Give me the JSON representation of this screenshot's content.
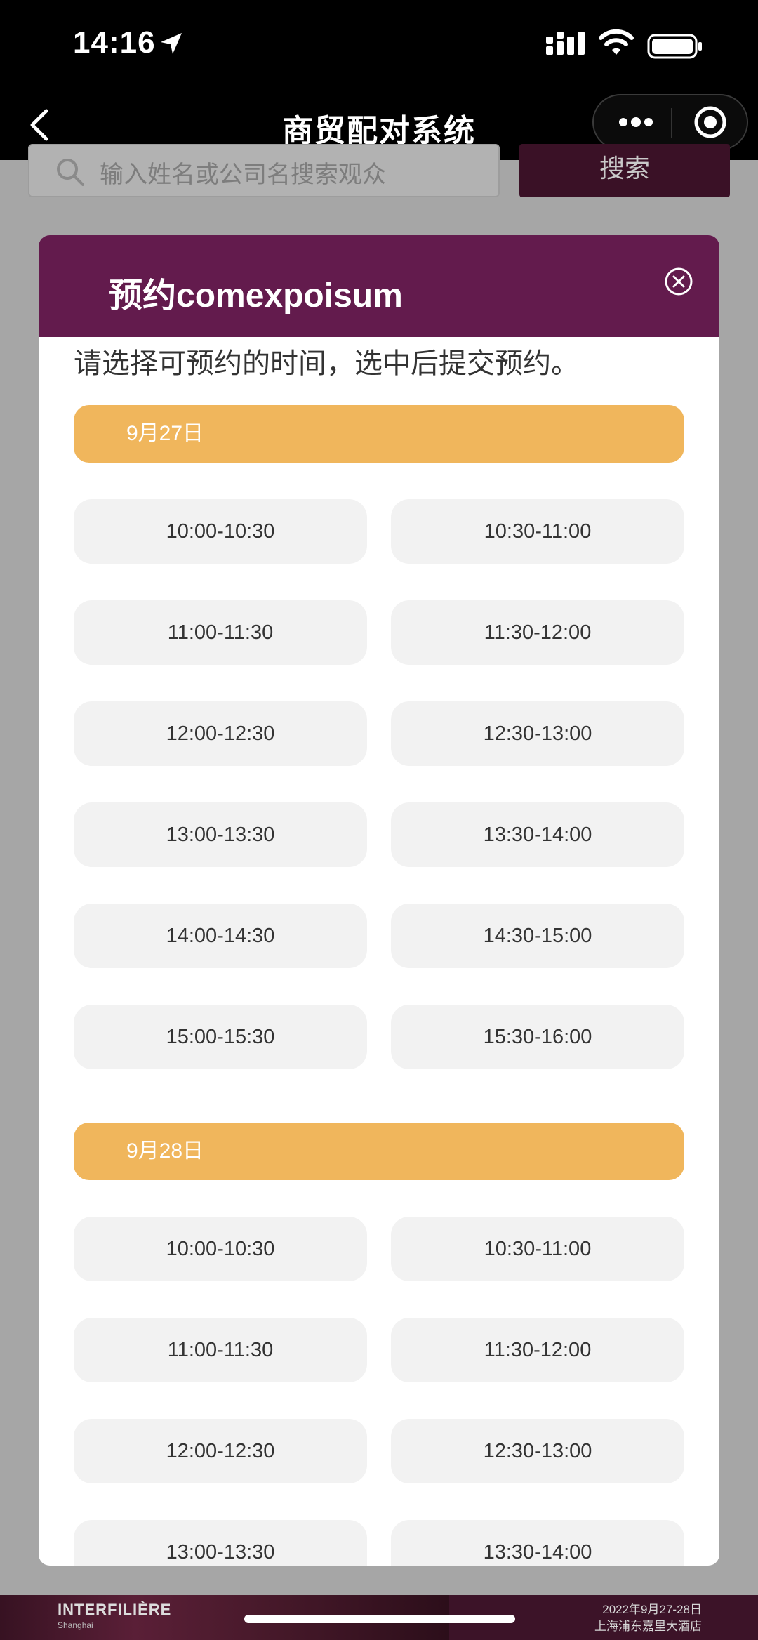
{
  "status_bar": {
    "time": "14:16"
  },
  "nav": {
    "title": "商贸配对系统"
  },
  "background": {
    "search_placeholder": "输入姓名或公司名搜索观众",
    "search_button": "搜索"
  },
  "modal": {
    "title": "预约comexpoisum",
    "instruction": "请选择可预约的时间，选中后提交预约。",
    "days": [
      {
        "date": "9月27日",
        "slots": [
          "10:00-10:30",
          "10:30-11:00",
          "11:00-11:30",
          "11:30-12:00",
          "12:00-12:30",
          "12:30-13:00",
          "13:00-13:30",
          "13:30-14:00",
          "14:00-14:30",
          "14:30-15:00",
          "15:00-15:30",
          "15:30-16:00"
        ]
      },
      {
        "date": "9月28日",
        "slots": [
          "10:00-10:30",
          "10:30-11:00",
          "11:00-11:30",
          "11:30-12:00",
          "12:00-12:30",
          "12:30-13:00",
          "13:00-13:30",
          "13:30-14:00"
        ]
      }
    ]
  },
  "banner": {
    "logo": "INTERFILIÈRE",
    "logo_sub": "Shanghai",
    "date": "2022年9月27-28日",
    "venue": "上海浦东嘉里大酒店"
  },
  "colors": {
    "header_purple": "#631b4d",
    "date_bar_orange": "#f0b65c",
    "slot_gray": "#f2f2f2"
  }
}
